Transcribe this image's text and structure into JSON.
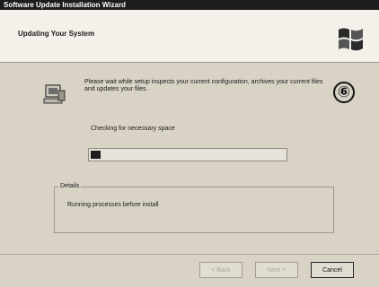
{
  "window": {
    "title": "Software Update Installation Wizard"
  },
  "header": {
    "title": "Updating Your System",
    "logo_icon": "windows-flag-icon"
  },
  "main": {
    "setup_icon": "setup-computer-icon",
    "intro": "Please wait while setup inspects your current configuration, archives your current files and updates your files.",
    "status": "Checking for necessary space",
    "progress": 0.05
  },
  "annotation": {
    "step": "⑥"
  },
  "details": {
    "legend": "Details",
    "message": "Running processes before install"
  },
  "buttons": {
    "back": "< Back",
    "next": "Next >",
    "cancel": "Cancel"
  }
}
